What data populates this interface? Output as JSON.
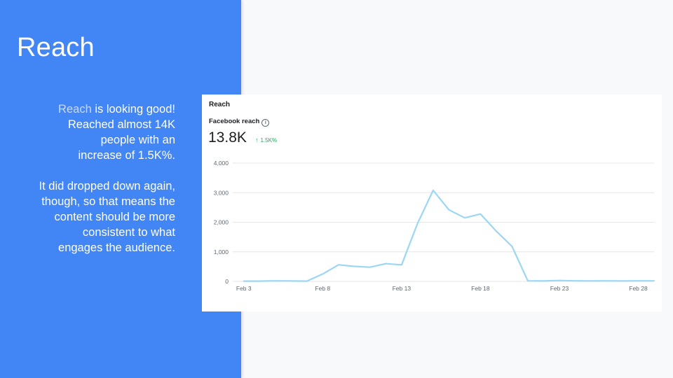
{
  "slide": {
    "title": "Reach",
    "body": {
      "highlight": "Reach",
      "line1_rest": " is looking good!",
      "line2": "Reached almost 14K",
      "line3": "people with an",
      "line4": "increase of 1.5K%.",
      "para2_line1": "It did dropped down again,",
      "para2_line2": "though, so that means the",
      "para2_line3": "content should be more",
      "para2_line4": "consistent to what",
      "para2_line5": "engages the audience."
    }
  },
  "card": {
    "title": "Reach",
    "metric_label": "Facebook reach",
    "metric_value": "13.8K",
    "metric_change": "1.5K%",
    "icons": {
      "info": "info-icon",
      "change": "arrow-up-icon"
    }
  },
  "colors": {
    "panel": "#4285f4",
    "line": "#9bd7f5",
    "positive": "#2aa464"
  },
  "chart_data": {
    "type": "line",
    "title": "Reach",
    "xlabel": "",
    "ylabel": "",
    "ylim": [
      0,
      4000
    ],
    "grid": true,
    "yticks": [
      {
        "value": 0,
        "label": "0"
      },
      {
        "value": 1000,
        "label": "1,000"
      },
      {
        "value": 2000,
        "label": "2,000"
      },
      {
        "value": 3000,
        "label": "3,000"
      },
      {
        "value": 4000,
        "label": "4,000"
      }
    ],
    "xticks": [
      {
        "day": 3,
        "label": "Feb 3"
      },
      {
        "day": 8,
        "label": "Feb 8"
      },
      {
        "day": 13,
        "label": "Feb 13"
      },
      {
        "day": 18,
        "label": "Feb 18"
      },
      {
        "day": 23,
        "label": "Feb 23"
      },
      {
        "day": 28,
        "label": "Feb 28"
      }
    ],
    "series": [
      {
        "name": "Facebook reach",
        "x": [
          3,
          4,
          5,
          6,
          7,
          8,
          9,
          10,
          11,
          12,
          13,
          14,
          15,
          16,
          17,
          18,
          19,
          20,
          21,
          22,
          23,
          24,
          25,
          26,
          27,
          28,
          29
        ],
        "y": [
          10,
          10,
          20,
          15,
          10,
          250,
          560,
          510,
          480,
          600,
          560,
          1950,
          3080,
          2420,
          2150,
          2280,
          1700,
          1180,
          20,
          15,
          30,
          20,
          15,
          20,
          15,
          20,
          20
        ]
      }
    ]
  }
}
